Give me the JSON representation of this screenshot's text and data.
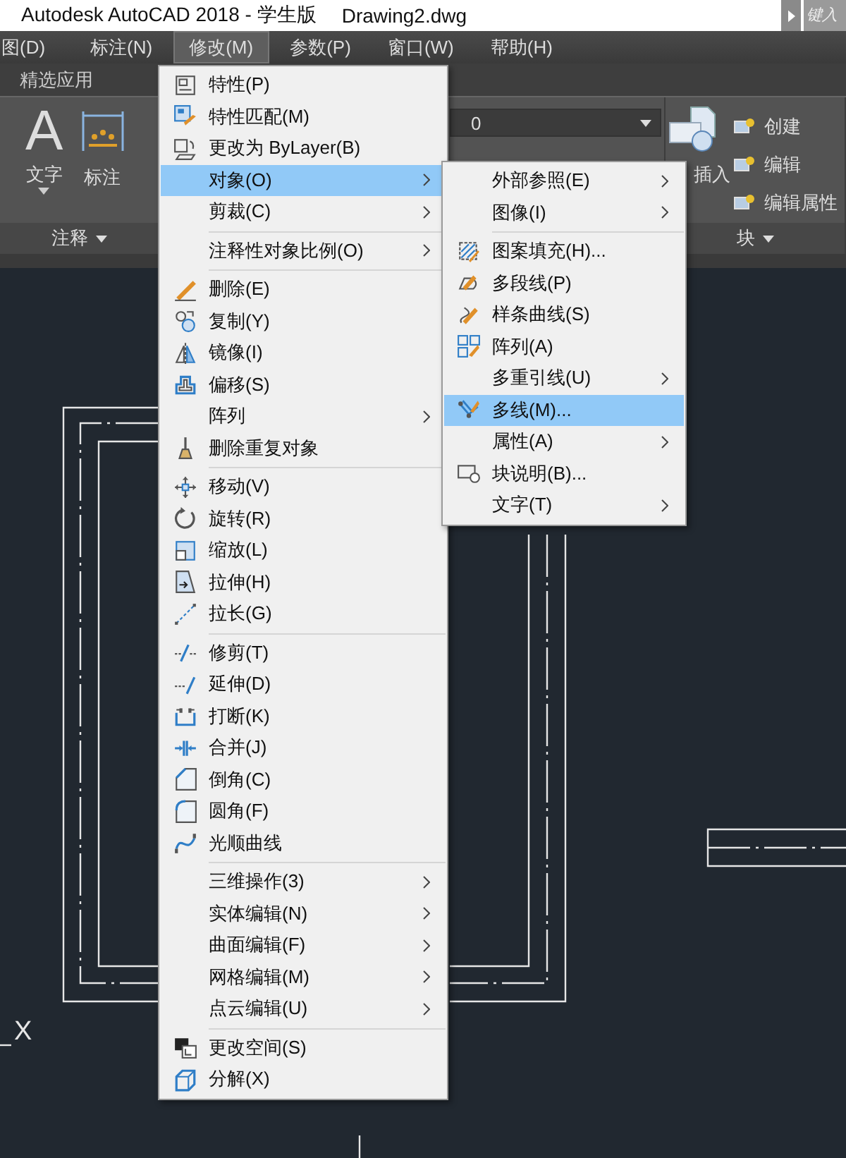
{
  "title_bar": {
    "title": "Autodesk AutoCAD 2018 - 学生版",
    "document": "Drawing2.dwg",
    "search_placeholder": "键入"
  },
  "menu_bar": [
    {
      "label": "图(D)",
      "selected": false
    },
    {
      "label": "标注(N)",
      "selected": false
    },
    {
      "label": "修改(M)",
      "selected": true
    },
    {
      "label": "参数(P)",
      "selected": false
    },
    {
      "label": "窗口(W)",
      "selected": false
    },
    {
      "label": "帮助(H)",
      "selected": false
    }
  ],
  "ribbon_tabs": [
    "精选应用"
  ],
  "ribbon": {
    "text_tool": {
      "glyph": "A",
      "label": "文字"
    },
    "dimension_tool": {
      "label": "标注"
    },
    "annotation_panel": "注释",
    "layer_value": "0",
    "insert_tool": "插入",
    "block_tools": [
      "创建",
      "编辑",
      "编辑属性"
    ],
    "block_panel": "块"
  },
  "main_menu": {
    "items": [
      {
        "kind": "command",
        "label": "特性(P)",
        "icon": true,
        "selected": false
      },
      {
        "kind": "command",
        "label": "特性匹配(M)",
        "icon": true,
        "selected": false
      },
      {
        "kind": "command",
        "label": "更改为 ByLayer(B)",
        "icon": true,
        "selected": false
      },
      {
        "kind": "submenu",
        "label": "对象(O)",
        "icon": false,
        "selected": true
      },
      {
        "kind": "submenu",
        "label": "剪裁(C)",
        "icon": false,
        "selected": false
      },
      {
        "kind": "separator"
      },
      {
        "kind": "submenu",
        "label": "注释性对象比例(O)",
        "icon": false,
        "selected": false
      },
      {
        "kind": "separator"
      },
      {
        "kind": "command",
        "label": "删除(E)",
        "icon": true,
        "selected": false
      },
      {
        "kind": "command",
        "label": "复制(Y)",
        "icon": true,
        "selected": false
      },
      {
        "kind": "command",
        "label": "镜像(I)",
        "icon": true,
        "selected": false
      },
      {
        "kind": "command",
        "label": "偏移(S)",
        "icon": true,
        "selected": false
      },
      {
        "kind": "submenu",
        "label": "阵列",
        "icon": false,
        "selected": false
      },
      {
        "kind": "command",
        "label": "删除重复对象",
        "icon": true,
        "selected": false
      },
      {
        "kind": "separator"
      },
      {
        "kind": "command",
        "label": "移动(V)",
        "icon": true,
        "selected": false
      },
      {
        "kind": "command",
        "label": "旋转(R)",
        "icon": true,
        "selected": false
      },
      {
        "kind": "command",
        "label": "缩放(L)",
        "icon": true,
        "selected": false
      },
      {
        "kind": "command",
        "label": "拉伸(H)",
        "icon": true,
        "selected": false
      },
      {
        "kind": "command",
        "label": "拉长(G)",
        "icon": true,
        "selected": false
      },
      {
        "kind": "separator"
      },
      {
        "kind": "command",
        "label": "修剪(T)",
        "icon": true,
        "selected": false
      },
      {
        "kind": "command",
        "label": "延伸(D)",
        "icon": true,
        "selected": false
      },
      {
        "kind": "command",
        "label": "打断(K)",
        "icon": true,
        "selected": false
      },
      {
        "kind": "command",
        "label": "合并(J)",
        "icon": true,
        "selected": false
      },
      {
        "kind": "command",
        "label": "倒角(C)",
        "icon": true,
        "selected": false
      },
      {
        "kind": "command",
        "label": "圆角(F)",
        "icon": true,
        "selected": false
      },
      {
        "kind": "command",
        "label": "光顺曲线",
        "icon": true,
        "selected": false
      },
      {
        "kind": "separator"
      },
      {
        "kind": "submenu",
        "label": "三维操作(3)",
        "icon": false,
        "selected": false
      },
      {
        "kind": "submenu",
        "label": "实体编辑(N)",
        "icon": false,
        "selected": false
      },
      {
        "kind": "submenu",
        "label": "曲面编辑(F)",
        "icon": false,
        "selected": false
      },
      {
        "kind": "submenu",
        "label": "网格编辑(M)",
        "icon": false,
        "selected": false
      },
      {
        "kind": "submenu",
        "label": "点云编辑(U)",
        "icon": false,
        "selected": false
      },
      {
        "kind": "separator"
      },
      {
        "kind": "command",
        "label": "更改空间(S)",
        "icon": true,
        "selected": false
      },
      {
        "kind": "command",
        "label": "分解(X)",
        "icon": true,
        "selected": false
      }
    ]
  },
  "object_submenu": {
    "items": [
      {
        "kind": "submenu",
        "label": "外部参照(E)",
        "icon": false,
        "selected": false
      },
      {
        "kind": "submenu",
        "label": "图像(I)",
        "icon": false,
        "selected": false
      },
      {
        "kind": "separator"
      },
      {
        "kind": "command",
        "label": "图案填充(H)...",
        "icon": true,
        "selected": false
      },
      {
        "kind": "command",
        "label": "多段线(P)",
        "icon": true,
        "selected": false
      },
      {
        "kind": "command",
        "label": "样条曲线(S)",
        "icon": true,
        "selected": false
      },
      {
        "kind": "command",
        "label": "阵列(A)",
        "icon": true,
        "selected": false
      },
      {
        "kind": "submenu",
        "label": "多重引线(U)",
        "icon": false,
        "selected": false
      },
      {
        "kind": "command",
        "label": "多线(M)...",
        "icon": true,
        "selected": true
      },
      {
        "kind": "submenu",
        "label": "属性(A)",
        "icon": false,
        "selected": false
      },
      {
        "kind": "command",
        "label": "块说明(B)...",
        "icon": true,
        "selected": false
      },
      {
        "kind": "submenu",
        "label": "文字(T)",
        "icon": false,
        "selected": false
      }
    ]
  },
  "canvas": {
    "ucs_axis_label": "X"
  }
}
